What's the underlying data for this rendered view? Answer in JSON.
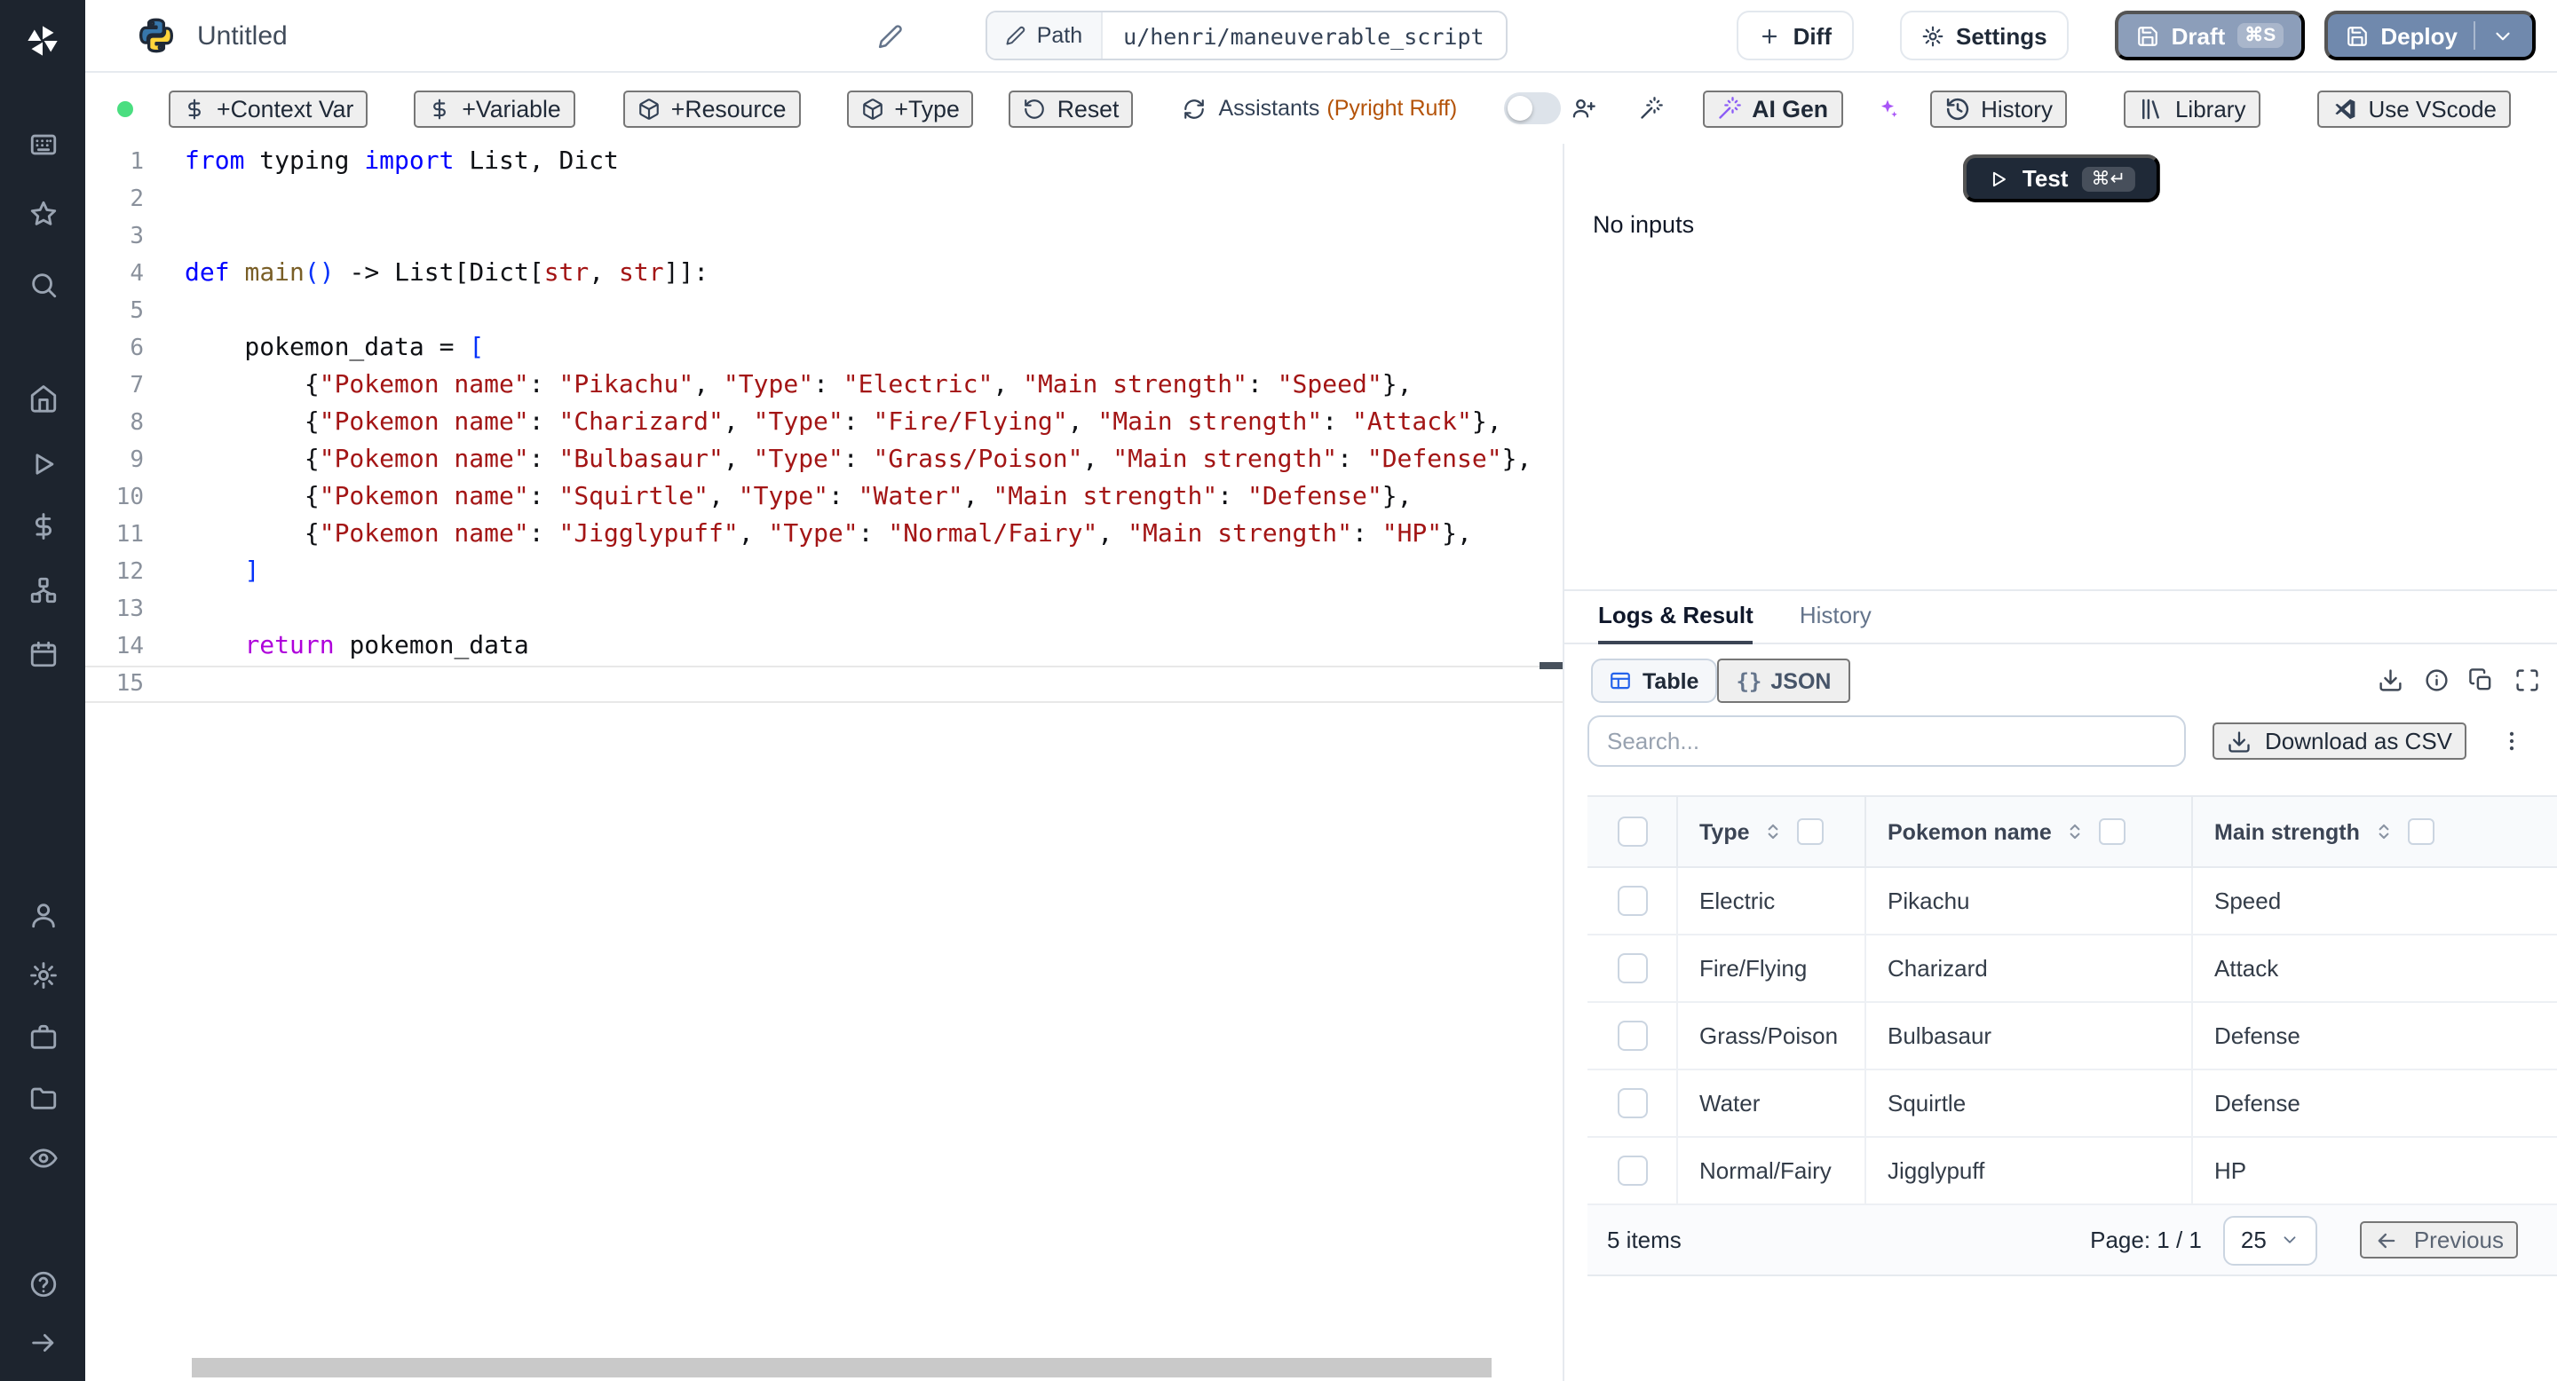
{
  "topbar": {
    "title": "Untitled",
    "path_label": "Path",
    "path_value": "u/henri/maneuverable_script",
    "diff_label": "Diff",
    "settings_label": "Settings",
    "draft_label": "Draft",
    "draft_shortcut": "⌘S",
    "deploy_label": "Deploy"
  },
  "toolbar": {
    "context_var": "+Context Var",
    "variable": "+Variable",
    "resource": "+Resource",
    "type": "+Type",
    "reset": "Reset",
    "assistants": "Assistants",
    "assistants_detail": "(Pyright Ruff)",
    "ai_gen": "AI Gen",
    "history": "History",
    "library": "Library",
    "use_vscode": "Use VScode"
  },
  "sidebar": {
    "items": [
      "windmill-logo",
      "quick-input",
      "favorites",
      "search",
      "home",
      "runs",
      "variables",
      "resources",
      "schedules",
      "user",
      "settings",
      "workers",
      "folders",
      "audit-logs",
      "help",
      "expand"
    ]
  },
  "editor": {
    "language": "python",
    "current_line": 15,
    "lines": [
      {
        "n": 1,
        "tokens": [
          [
            "from",
            "kw"
          ],
          [
            " typing ",
            "pl"
          ],
          [
            "import",
            "kw"
          ],
          [
            " List, Dict",
            "pl"
          ]
        ]
      },
      {
        "n": 2,
        "tokens": []
      },
      {
        "n": 3,
        "tokens": []
      },
      {
        "n": 4,
        "tokens": [
          [
            "def",
            "kw"
          ],
          [
            " ",
            "pl"
          ],
          [
            "main",
            "fn"
          ],
          [
            "(",
            "br"
          ],
          [
            ")",
            "br"
          ],
          [
            " -> List[Dict[",
            "pl"
          ],
          [
            "str",
            "typ"
          ],
          [
            ", ",
            "pl"
          ],
          [
            "str",
            "typ"
          ],
          [
            "]]:",
            "pl"
          ]
        ]
      },
      {
        "n": 5,
        "tokens": []
      },
      {
        "n": 6,
        "tokens": [
          [
            "    pokemon_data = ",
            "pl"
          ],
          [
            "[",
            "br"
          ]
        ]
      },
      {
        "n": 7,
        "tokens": [
          [
            "        {",
            "pl"
          ],
          [
            "\"Pokemon name\"",
            "str"
          ],
          [
            ": ",
            "pl"
          ],
          [
            "\"Pikachu\"",
            "str"
          ],
          [
            ", ",
            "pl"
          ],
          [
            "\"Type\"",
            "str"
          ],
          [
            ": ",
            "pl"
          ],
          [
            "\"Electric\"",
            "str"
          ],
          [
            ", ",
            "pl"
          ],
          [
            "\"Main strength\"",
            "str"
          ],
          [
            ": ",
            "pl"
          ],
          [
            "\"Speed\"",
            "str"
          ],
          [
            "},",
            "pl"
          ]
        ]
      },
      {
        "n": 8,
        "tokens": [
          [
            "        {",
            "pl"
          ],
          [
            "\"Pokemon name\"",
            "str"
          ],
          [
            ": ",
            "pl"
          ],
          [
            "\"Charizard\"",
            "str"
          ],
          [
            ", ",
            "pl"
          ],
          [
            "\"Type\"",
            "str"
          ],
          [
            ": ",
            "pl"
          ],
          [
            "\"Fire/Flying\"",
            "str"
          ],
          [
            ", ",
            "pl"
          ],
          [
            "\"Main strength\"",
            "str"
          ],
          [
            ": ",
            "pl"
          ],
          [
            "\"Attack\"",
            "str"
          ],
          [
            "},",
            "pl"
          ]
        ]
      },
      {
        "n": 9,
        "tokens": [
          [
            "        {",
            "pl"
          ],
          [
            "\"Pokemon name\"",
            "str"
          ],
          [
            ": ",
            "pl"
          ],
          [
            "\"Bulbasaur\"",
            "str"
          ],
          [
            ", ",
            "pl"
          ],
          [
            "\"Type\"",
            "str"
          ],
          [
            ": ",
            "pl"
          ],
          [
            "\"Grass/Poison\"",
            "str"
          ],
          [
            ", ",
            "pl"
          ],
          [
            "\"Main strength\"",
            "str"
          ],
          [
            ": ",
            "pl"
          ],
          [
            "\"Defense\"",
            "str"
          ],
          [
            "},",
            "pl"
          ]
        ]
      },
      {
        "n": 10,
        "tokens": [
          [
            "        {",
            "pl"
          ],
          [
            "\"Pokemon name\"",
            "str"
          ],
          [
            ": ",
            "pl"
          ],
          [
            "\"Squirtle\"",
            "str"
          ],
          [
            ", ",
            "pl"
          ],
          [
            "\"Type\"",
            "str"
          ],
          [
            ": ",
            "pl"
          ],
          [
            "\"Water\"",
            "str"
          ],
          [
            ", ",
            "pl"
          ],
          [
            "\"Main strength\"",
            "str"
          ],
          [
            ": ",
            "pl"
          ],
          [
            "\"Defense\"",
            "str"
          ],
          [
            "},",
            "pl"
          ]
        ]
      },
      {
        "n": 11,
        "tokens": [
          [
            "        {",
            "pl"
          ],
          [
            "\"Pokemon name\"",
            "str"
          ],
          [
            ": ",
            "pl"
          ],
          [
            "\"Jigglypuff\"",
            "str"
          ],
          [
            ", ",
            "pl"
          ],
          [
            "\"Type\"",
            "str"
          ],
          [
            ": ",
            "pl"
          ],
          [
            "\"Normal/Fairy\"",
            "str"
          ],
          [
            ", ",
            "pl"
          ],
          [
            "\"Main strength\"",
            "str"
          ],
          [
            ": ",
            "pl"
          ],
          [
            "\"HP\"",
            "str"
          ],
          [
            "},",
            "pl"
          ]
        ]
      },
      {
        "n": 12,
        "tokens": [
          [
            "    ",
            "pl"
          ],
          [
            "]",
            "br"
          ]
        ]
      },
      {
        "n": 13,
        "tokens": []
      },
      {
        "n": 14,
        "tokens": [
          [
            "    ",
            "pl"
          ],
          [
            "return",
            "ret"
          ],
          [
            " pokemon_data",
            "pl"
          ]
        ]
      },
      {
        "n": 15,
        "tokens": []
      }
    ]
  },
  "runner": {
    "test_label": "Test",
    "test_shortcut": "⌘↵",
    "no_inputs": "No inputs"
  },
  "results": {
    "tabs": {
      "logs": "Logs & Result",
      "history": "History"
    },
    "view": {
      "table": "Table",
      "json": "JSON",
      "braces_glyph": "{}"
    },
    "search_placeholder": "Search...",
    "download_csv": "Download as CSV",
    "table": {
      "columns": [
        "Type",
        "Pokemon name",
        "Main strength"
      ],
      "rows": [
        [
          "Electric",
          "Pikachu",
          "Speed"
        ],
        [
          "Fire/Flying",
          "Charizard",
          "Attack"
        ],
        [
          "Grass/Poison",
          "Bulbasaur",
          "Defense"
        ],
        [
          "Water",
          "Squirtle",
          "Defense"
        ],
        [
          "Normal/Fairy",
          "Jigglypuff",
          "HP"
        ]
      ]
    },
    "footer": {
      "items": "5 items",
      "page": "Page: 1 / 1",
      "page_size": "25",
      "previous": "Previous"
    }
  },
  "colors": {
    "sidebar_bg": "#1d242e",
    "status_green": "#4ade80",
    "draft_bg": "#8c9eba",
    "deploy_bg": "#7089ad",
    "test_bg": "#1f2937",
    "ai_violet": "#8b5cf6",
    "assistant_amber": "#b45309",
    "table_icon_blue": "#2563eb",
    "keyword_blue": "#0000ff",
    "string_red": "#a31515"
  }
}
